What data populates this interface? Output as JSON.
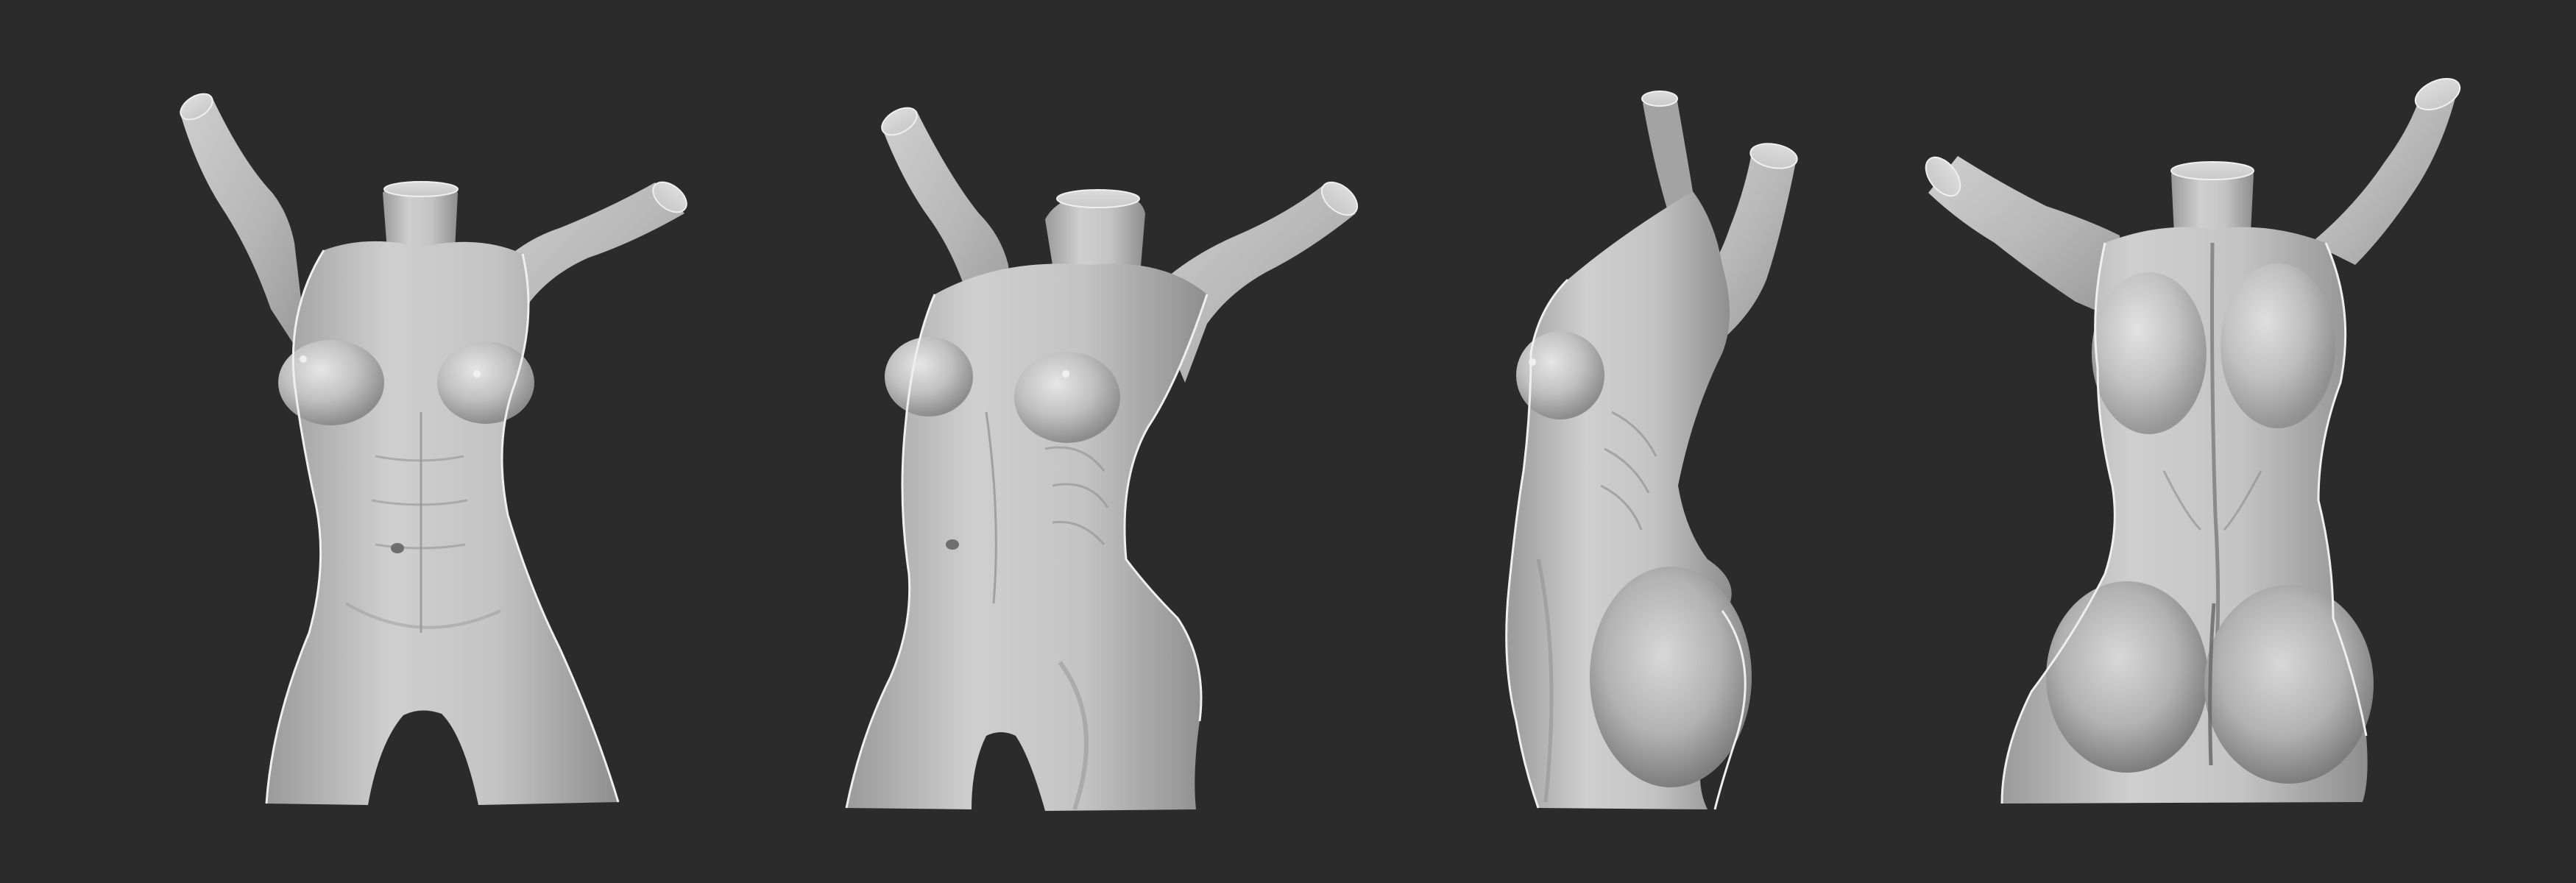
{
  "canvas": {
    "background": "#2b2b2b"
  },
  "colors": {
    "base": "#b9b9b9",
    "light": "#e3e3e3",
    "highlight": "#f4f4f4",
    "shade": "#8f8f8f",
    "deep_shade": "#6d6d6d",
    "rim": "#ededed"
  },
  "views": [
    {
      "id": "front",
      "icon": "front-view-figure-icon"
    },
    {
      "id": "three-quarter",
      "icon": "three-quarter-view-figure-icon"
    },
    {
      "id": "side",
      "icon": "side-view-figure-icon"
    },
    {
      "id": "back",
      "icon": "back-view-figure-icon"
    }
  ]
}
